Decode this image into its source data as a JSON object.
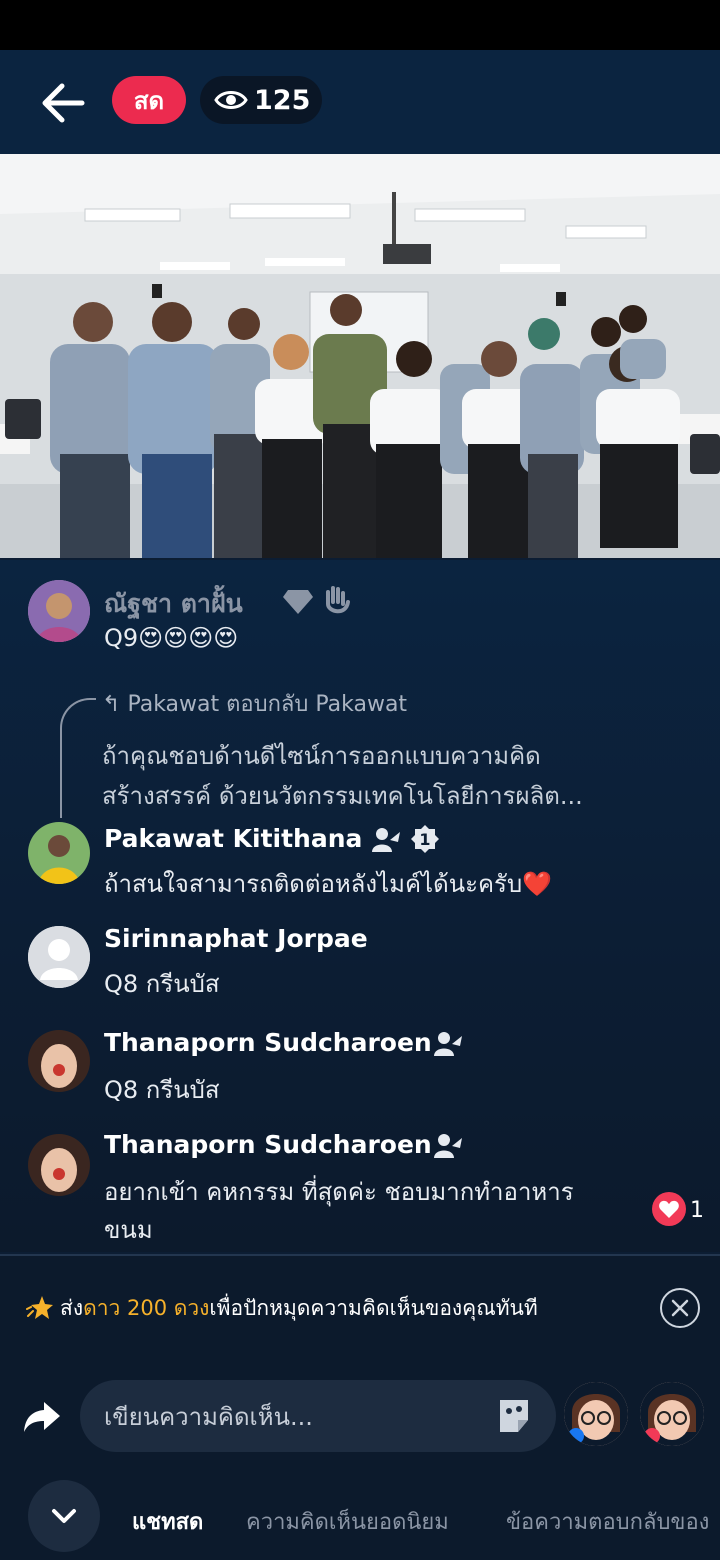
{
  "header": {
    "live_label": "สด",
    "viewer_count": "125"
  },
  "comments": [
    {
      "name": "ณัฐชา ตาฝั้น",
      "text": "Q9😍😍😍😍"
    },
    {
      "reply_header": "Pakawat ตอบกลับ Pakawat",
      "reply_line1": "ถ้าคุณชอบด้านดีไซน์การออกแบบความคิด",
      "reply_line2": "สร้างสรรค์ ด้วยนวัตกรรมเทคโนโลยีการผลิต...",
      "name": "Pakawat Kitithana",
      "text": "ถ้าสนใจสามารถติดต่อหลังไมค์ได้นะครับ❤️"
    },
    {
      "name": "Sirinnaphat Jorpae",
      "text": "Q8 กรีนบัส"
    },
    {
      "name": "Thanaporn Sudcharoen",
      "text": "Q8 กรีนบัส"
    },
    {
      "name": "Thanaporn Sudcharoen",
      "text_line1": "อยากเข้า คหกรรม ที่สุดค่ะ ชอบมากทำอาหาร",
      "text_line2": "ขนม",
      "like_count": "1"
    }
  ],
  "promo": {
    "prefix": "ส่ง",
    "highlight": "ดาว 200 ดวง",
    "suffix": "เพื่อปักหมุดความคิดเห็นของคุณทันที"
  },
  "composer": {
    "placeholder": "เขียนความคิดเห็น..."
  },
  "tabs": [
    "แชทสด",
    "ความคิดเห็นยอดนิยม",
    "ข้อความตอบกลับของ"
  ],
  "colors": {
    "live_red": "#ec2b4f",
    "star_gold": "#f6b12b",
    "background": "#0c1d33"
  }
}
